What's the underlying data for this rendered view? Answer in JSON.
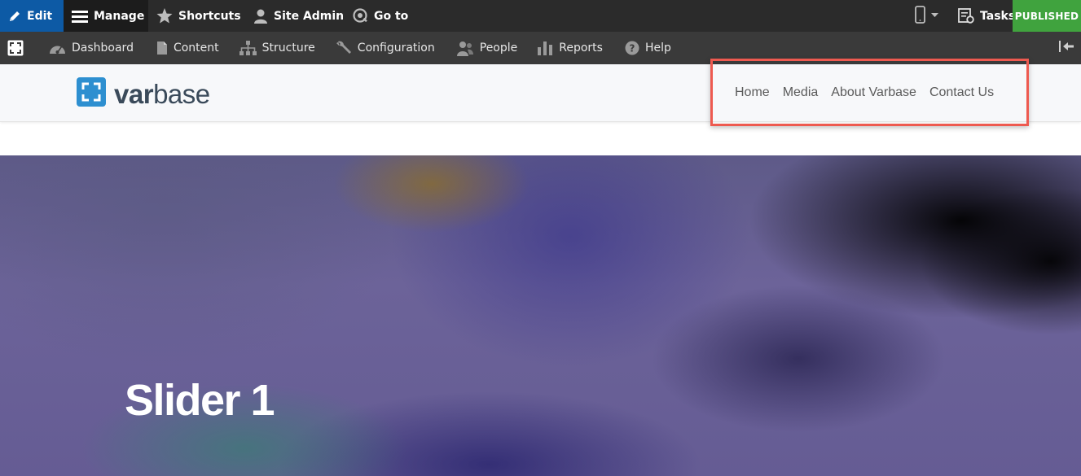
{
  "toolbar": {
    "edit_label": "Edit",
    "manage_label": "Manage",
    "shortcuts_label": "Shortcuts",
    "site_admin_label": "Site Admin",
    "goto_label": "Go to",
    "tasks_label": "Tasks",
    "status_label": "PUBLISHED"
  },
  "tray": {
    "items": [
      {
        "label": "Dashboard",
        "icon": "dashboard-icon"
      },
      {
        "label": "Content",
        "icon": "document-icon"
      },
      {
        "label": "Structure",
        "icon": "sitemap-icon"
      },
      {
        "label": "Configuration",
        "icon": "wrench-icon"
      },
      {
        "label": "People",
        "icon": "people-icon"
      },
      {
        "label": "Reports",
        "icon": "bar-chart-icon"
      },
      {
        "label": "Help",
        "icon": "help-icon"
      }
    ]
  },
  "brand": {
    "name_bold": "var",
    "name_rest": "base"
  },
  "nav": {
    "links": [
      "Home",
      "Media",
      "About Varbase",
      "Contact Us"
    ]
  },
  "slider": {
    "title": "Slider 1"
  },
  "colors": {
    "edit_bg": "#0d5aa5",
    "published_bg": "#40a33e",
    "highlight_border": "#ee5a50",
    "brand_blue": "#2d8fd0"
  }
}
